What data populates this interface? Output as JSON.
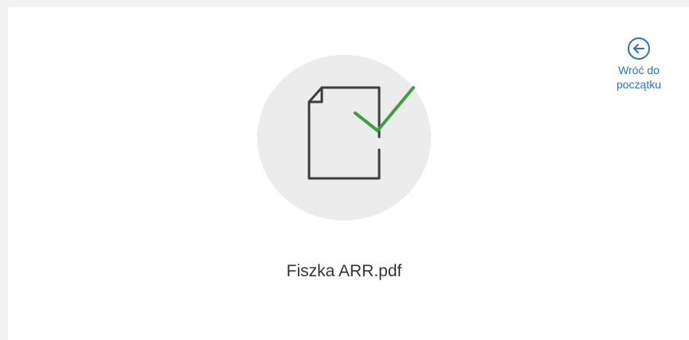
{
  "back": {
    "label_line1": "Wróć do",
    "label_line2": "początku"
  },
  "file": {
    "name": "Fiszka ARR.pdf",
    "icon": "document-check-icon",
    "status": "success"
  },
  "colors": {
    "accent": "#2a73c6",
    "success": "#3aa33f",
    "icon_stroke": "#3d3d3d",
    "circle_bg": "#ececec",
    "page_bg": "#f2f2f2"
  }
}
